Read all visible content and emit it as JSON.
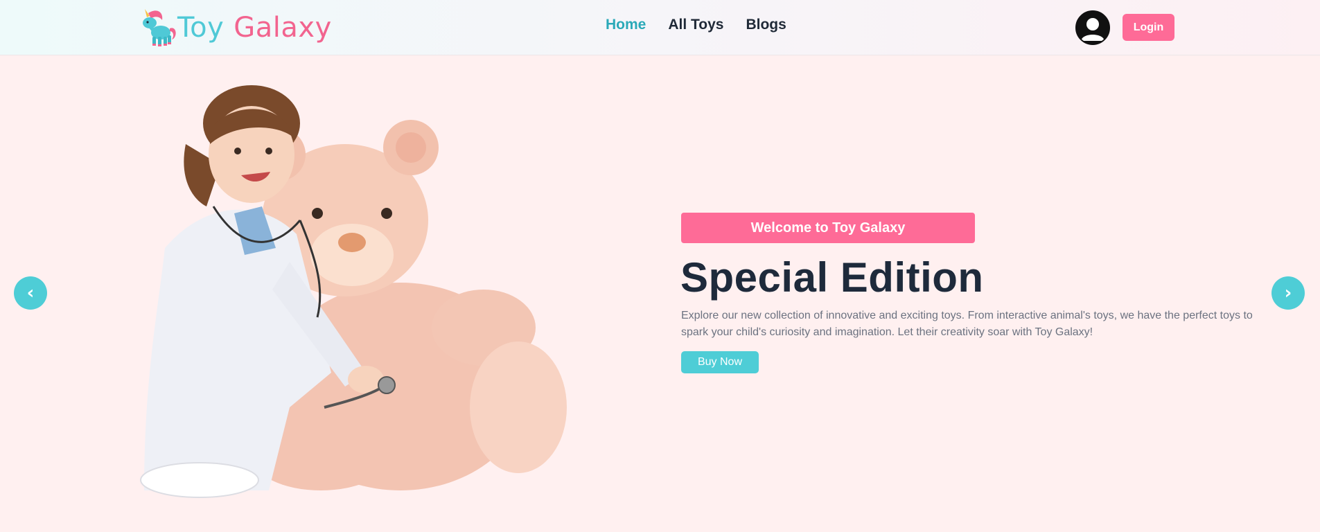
{
  "header": {
    "logo": {
      "word1": "Toy",
      "word2": "Galaxy",
      "icon": "unicorn-icon"
    },
    "nav": [
      {
        "label": "Home",
        "active": true
      },
      {
        "label": "All Toys",
        "active": false
      },
      {
        "label": "Blogs",
        "active": false
      }
    ],
    "avatar_icon": "user-avatar-icon",
    "login_label": "Login"
  },
  "hero": {
    "badge": "Welcome to Toy Galaxy",
    "title": "Special Edition",
    "description": "Explore our new collection of innovative and exciting toys. From interactive animal's toys, we have the perfect toys to spark your child's curiosity and imagination. Let their creativity soar with Toy Galaxy!",
    "cta_label": "Buy Now",
    "image": "girl-with-teddy-bear-illustration",
    "prev_arrow": "‹",
    "next_arrow": "›"
  },
  "colors": {
    "primary_pink": "#fe6b97",
    "teal": "#4ecdd6",
    "nav_active": "#2aa9b8",
    "heading": "#1e2a3b",
    "hero_bg": "#fff0f0"
  }
}
